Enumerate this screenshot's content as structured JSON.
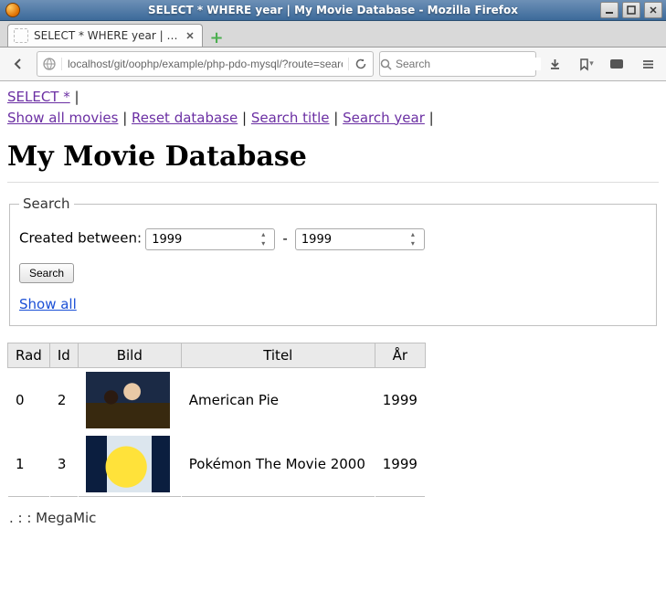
{
  "window": {
    "title": "SELECT * WHERE year | My Movie Database - Mozilla Firefox"
  },
  "tab": {
    "label": "SELECT * WHERE year | My …"
  },
  "nav": {
    "url": "localhost/git/oophp/example/php-pdo-mysql/?route=search-year",
    "search_placeholder": "Search"
  },
  "links": {
    "select_all": "SELECT *",
    "show_all_movies": "Show all movies",
    "reset_db": "Reset database",
    "search_title": "Search title",
    "search_year": "Search year"
  },
  "heading": "My Movie Database",
  "search": {
    "legend": "Search",
    "between_label": "Created between:",
    "year_from": "1999",
    "dash": "-",
    "year_to": "1999",
    "button": "Search",
    "show_all": "Show all"
  },
  "table": {
    "headers": {
      "rad": "Rad",
      "id": "Id",
      "bild": "Bild",
      "titel": "Titel",
      "ar": "År"
    },
    "rows": [
      {
        "rad": "0",
        "id": "2",
        "thumb": "thumb1",
        "titel": "American Pie",
        "ar": "1999"
      },
      {
        "rad": "1",
        "id": "3",
        "thumb": "thumb2",
        "titel": "Pokémon The Movie 2000",
        "ar": "1999"
      }
    ]
  },
  "footer": ". : :  MegaMic"
}
